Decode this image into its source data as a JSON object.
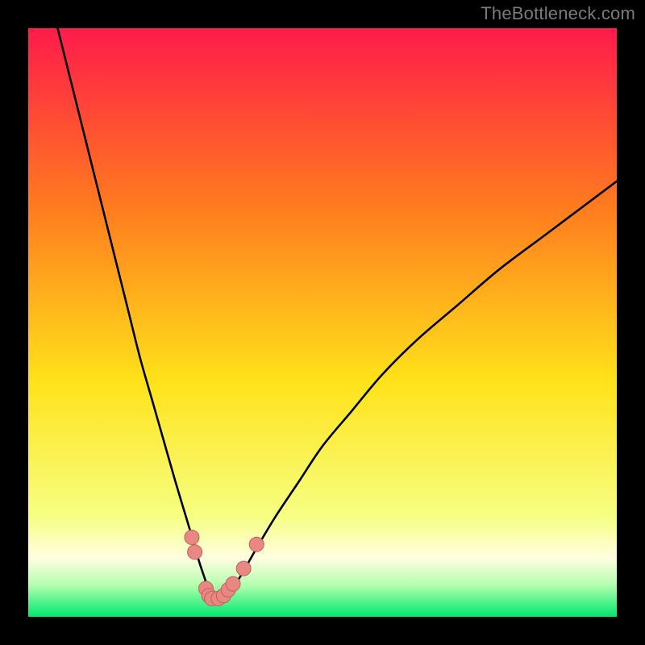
{
  "watermark": "TheBottleneck.com",
  "colors": {
    "background": "#000000",
    "gradient_top": "#ff1b4b",
    "gradient_mid_upper": "#ff7a1f",
    "gradient_mid": "#ffe21a",
    "gradient_lower": "#f6ff82",
    "gradient_band_light": "#fffde0",
    "gradient_band_green_light": "#b6ffb0",
    "gradient_bottom": "#00e86f",
    "curve": "#000000",
    "marker_fill": "#e98782",
    "marker_stroke": "#c45f5a"
  },
  "chart_data": {
    "type": "line",
    "title": "",
    "xlabel": "",
    "ylabel": "",
    "xlim": [
      0,
      100
    ],
    "ylim": [
      0,
      100
    ],
    "curve": {
      "name": "bottleneck-curve",
      "x": [
        5,
        7,
        9,
        11,
        13,
        15,
        17,
        19,
        21,
        23,
        25,
        26.5,
        28,
        29,
        30,
        30.5,
        31,
        31.5,
        32,
        33,
        34,
        35.5,
        37,
        39,
        42,
        46,
        50,
        55,
        60,
        66,
        73,
        80,
        88,
        96,
        100
      ],
      "y": [
        100,
        92,
        84,
        76,
        68,
        60,
        52,
        44,
        37,
        30,
        23,
        18,
        13,
        9.5,
        6.5,
        5,
        3.8,
        3.2,
        3.0,
        3.2,
        4.2,
        6.0,
        8.5,
        12,
        17,
        23,
        29,
        35,
        41,
        47,
        53,
        59,
        65,
        71,
        74
      ]
    },
    "markers": {
      "name": "highlight-points",
      "points": [
        {
          "x": 27.8,
          "y": 13.5
        },
        {
          "x": 28.3,
          "y": 11.0
        },
        {
          "x": 30.2,
          "y": 4.8
        },
        {
          "x": 30.7,
          "y": 3.6
        },
        {
          "x": 31.2,
          "y": 3.1
        },
        {
          "x": 32.3,
          "y": 3.1
        },
        {
          "x": 33.2,
          "y": 3.6
        },
        {
          "x": 34.0,
          "y": 4.6
        },
        {
          "x": 34.8,
          "y": 5.6
        },
        {
          "x": 36.6,
          "y": 8.2
        },
        {
          "x": 38.8,
          "y": 12.3
        }
      ]
    }
  }
}
